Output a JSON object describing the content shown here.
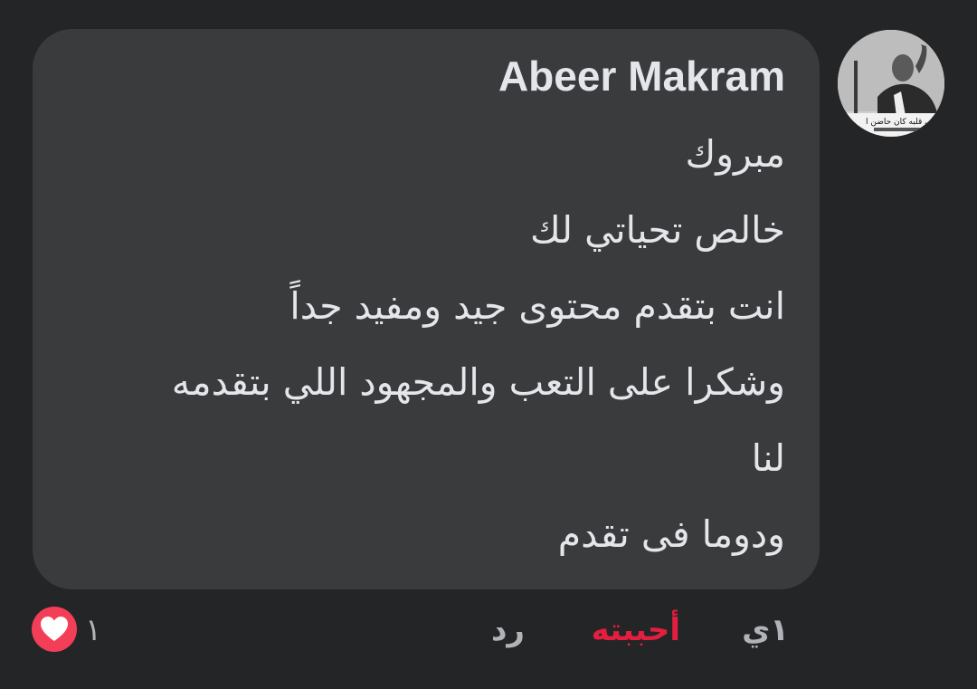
{
  "comment": {
    "author": "Abeer Makram",
    "avatar_caption": "فى قلبه كان حاضن ا",
    "lines": [
      "مبروك",
      "خالص تحياتي لك",
      "انت بتقدم محتوى جيد ومفيد جداً",
      "وشكرا على التعب والمجهود اللي بتقدمه",
      "لنا",
      "ودوما فى تقدم"
    ]
  },
  "actions": {
    "time": "١ي",
    "like_label": "أحببته",
    "reply_label": "رد"
  },
  "reactions": {
    "icon": "love-icon",
    "count": "١"
  },
  "colors": {
    "background": "#242526",
    "bubble": "#3a3b3c",
    "text": "#e4e6eb",
    "muted": "#b0b3b8",
    "like_active": "#e41e3f",
    "love": "#f33e58"
  }
}
